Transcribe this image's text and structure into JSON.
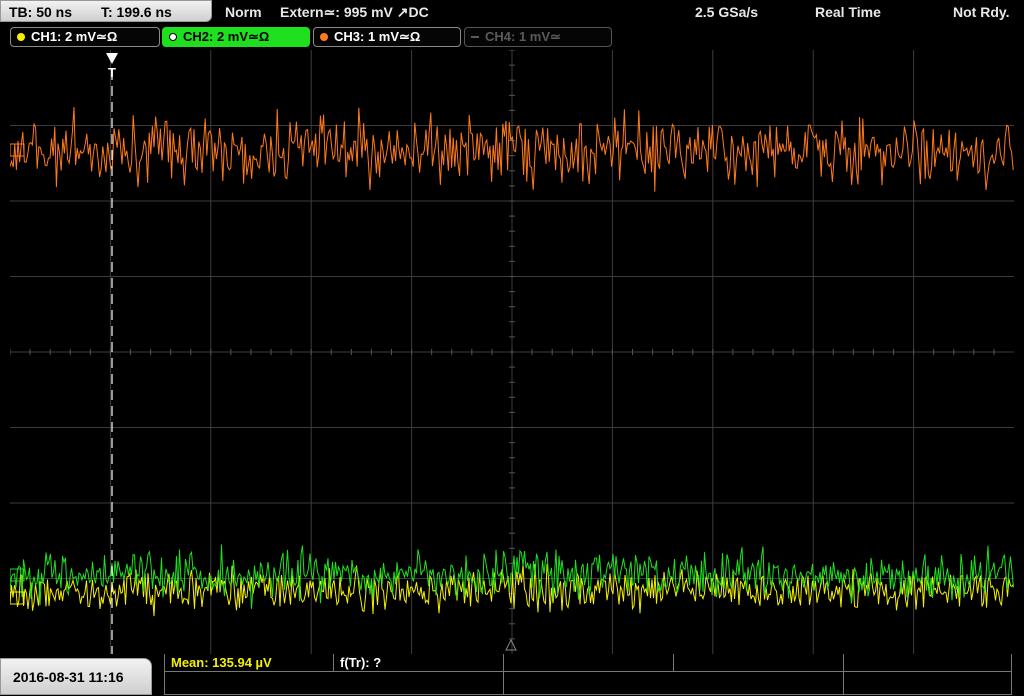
{
  "header": {
    "timebase": "TB: 50 ns",
    "trigger_time": "T: 199.6 ns",
    "mode": "Norm",
    "trigger_source": "Extern≃: 995 mV ↗DC",
    "sample_rate": "2.5 GSa/s",
    "acq_mode": "Real Time",
    "status": "Not Rdy."
  },
  "channels": [
    {
      "id": "ch1",
      "label": "CH1: 2 mV≃Ω",
      "color": "#f5f000",
      "active": false,
      "enabled": true
    },
    {
      "id": "ch2",
      "label": "CH2: 2 mV≃Ω",
      "color": "#1ee01e",
      "active": true,
      "enabled": true
    },
    {
      "id": "ch3",
      "label": "CH3: 1 mV≃Ω",
      "color": "#ff7a1a",
      "active": false,
      "enabled": true
    },
    {
      "id": "ch4",
      "label": "CH4: 1 mV≃",
      "color": "#5a5a5a",
      "active": false,
      "enabled": false
    }
  ],
  "trigger_marker": "T",
  "footer": {
    "datetime": "2016-08-31 11:16",
    "measurements": [
      {
        "label": "Mean: 135.94 µV",
        "color": "#f5f000"
      },
      {
        "label": "f(Tr): ?",
        "color": "#ffffff"
      }
    ]
  },
  "colors": {
    "grid": "#3c3c3c",
    "trigger_line": "#ffffff",
    "ch1_trace": "#f5f000",
    "ch2_trace": "#1ee01e",
    "ch3_trace": "#ff7a1a"
  }
}
